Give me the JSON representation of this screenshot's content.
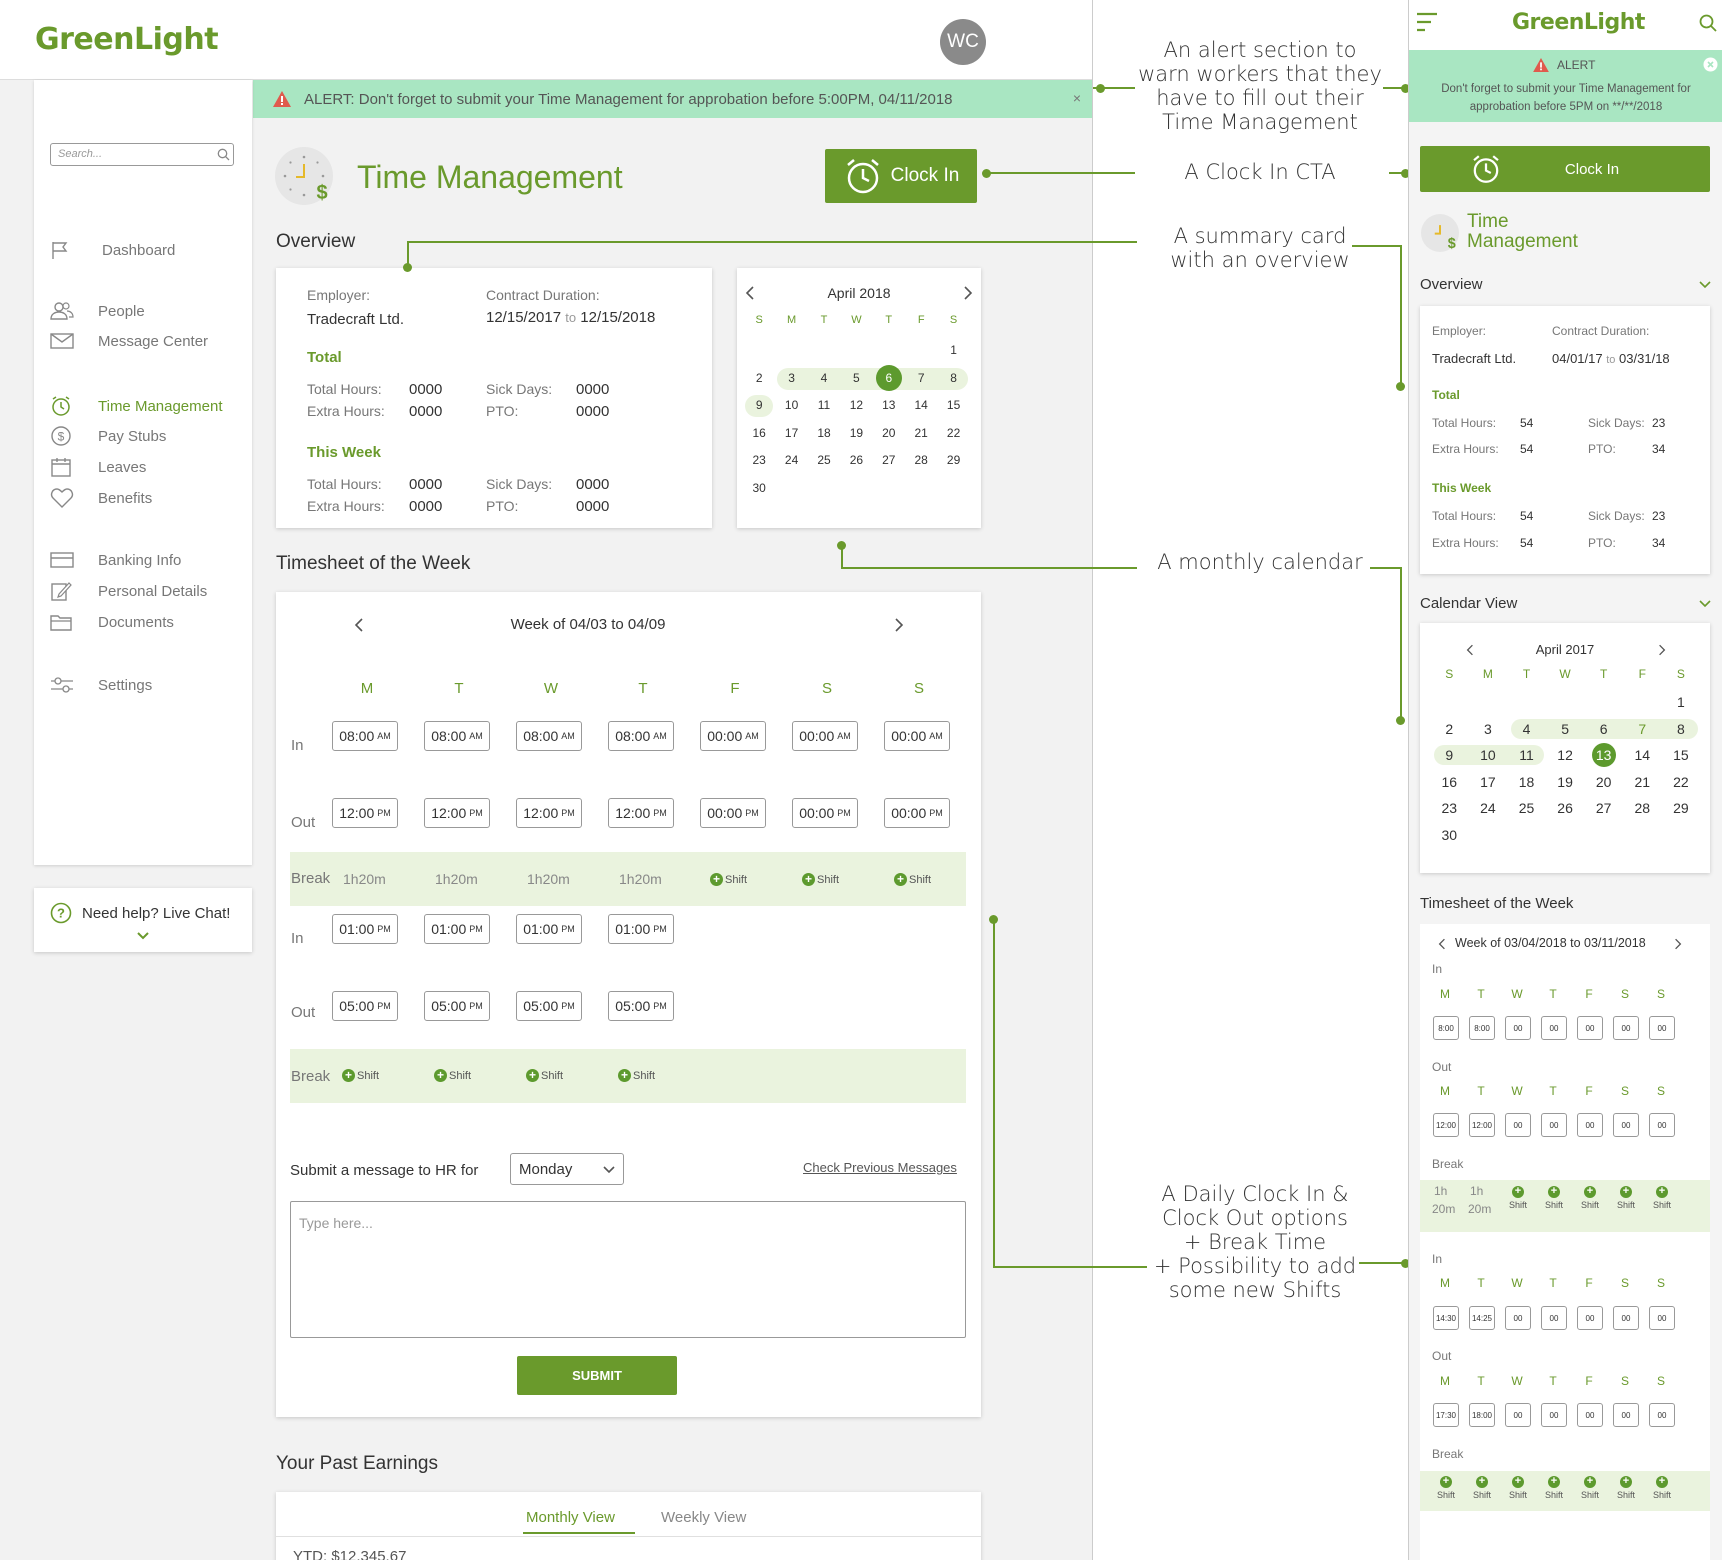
{
  "brand": {
    "logo": "GreenLight",
    "avatar_initials": "WC"
  },
  "alert": {
    "text": "ALERT: Don't forget to submit your Time Management for approbation before 5:00PM,  04/11/2018",
    "close": "×"
  },
  "search": {
    "placeholder": "Search..."
  },
  "nav": {
    "dashboard": "Dashboard",
    "people": "People",
    "messages": "Message Center",
    "time": "Time Management",
    "paystubs": "Pay Stubs",
    "leaves": "Leaves",
    "benefits": "Benefits",
    "banking": "Banking Info",
    "personal": "Personal Details",
    "documents": "Documents",
    "settings": "Settings"
  },
  "help": {
    "text": "Need help? Live Chat!"
  },
  "page": {
    "title": "Time Management",
    "clock_in": "Clock In",
    "overview": "Overview",
    "timesheet_title": "Timesheet of the Week",
    "earnings_title": "Your Past Earnings"
  },
  "overview": {
    "employer_label": "Employer:",
    "employer": "Tradecraft Ltd.",
    "contract_label": "Contract Duration:",
    "contract_from": "12/15/2017",
    "contract_to_word": "to",
    "contract_to": "12/15/2018",
    "total_heading": "Total",
    "week_heading": "This Week",
    "total_hours_label": "Total Hours:",
    "extra_hours_label": "Extra Hours:",
    "sick_label": "Sick Days:",
    "pto_label": "PTO:",
    "total": {
      "hours": "0000",
      "extra": "0000",
      "sick": "0000",
      "pto": "0000"
    },
    "week": {
      "hours": "0000",
      "extra": "0000",
      "sick": "0000",
      "pto": "0000"
    }
  },
  "calendar": {
    "month": "April 2018",
    "days": [
      "S",
      "M",
      "T",
      "W",
      "T",
      "F",
      "S"
    ],
    "weeks": [
      [
        "",
        "",
        "",
        "",
        "",
        "",
        "1"
      ],
      [
        "2",
        "3",
        "4",
        "5",
        "6",
        "7",
        "8"
      ],
      [
        "9",
        "10",
        "11",
        "12",
        "13",
        "14",
        "15"
      ],
      [
        "16",
        "17",
        "18",
        "19",
        "20",
        "21",
        "22"
      ],
      [
        "23",
        "24",
        "25",
        "26",
        "27",
        "28",
        "29"
      ],
      [
        "30",
        "",
        "",
        "",
        "",
        "",
        ""
      ]
    ],
    "selected": "6"
  },
  "timesheet": {
    "week_label": "Week of 04/03 to 04/09",
    "days": [
      "M",
      "T",
      "W",
      "T",
      "F",
      "S",
      "S"
    ],
    "row_in": "In",
    "row_out": "Out",
    "row_break": "Break",
    "shift": "Shift",
    "in1": [
      "08:00",
      "08:00",
      "08:00",
      "08:00",
      "00:00",
      "00:00",
      "00:00"
    ],
    "in1_ampm": "AM",
    "out1": [
      "12:00",
      "12:00",
      "12:00",
      "12:00",
      "00:00",
      "00:00",
      "00:00"
    ],
    "pm": "PM",
    "break1": [
      "1h20m",
      "1h20m",
      "1h20m",
      "1h20m"
    ],
    "in2": [
      "01:00",
      "01:00",
      "01:00",
      "01:00"
    ],
    "out2": [
      "05:00",
      "05:00",
      "05:00",
      "05:00"
    ],
    "message_label": "Submit a message to HR for",
    "message_day": "Monday",
    "check_previous": "Check Previous Messages",
    "textarea_placeholder": "Type here...",
    "submit": "SUBMIT"
  },
  "earnings": {
    "tab_monthly": "Monthly View",
    "tab_weekly": "Weekly View",
    "ytd": "YTD: $12,345.67"
  },
  "annotations": {
    "alert": "An alert section to\nwarn workers that they\nhave to fill out their\nTime Management",
    "clockin": "A Clock In CTA",
    "summary": "A summary card\nwith an overview",
    "calendar": "A monthly calendar",
    "daily": "A Daily Clock In &\nClock Out options\n+ Break Time\n+ Possibility to add\nsome new Shifts"
  },
  "mobile": {
    "alert_title": "ALERT",
    "alert_text": "Don't forget to submit your Time Management for approbation before 5PM on **/**/2018",
    "clock_in": "Clock In",
    "title_line1": "Time",
    "title_line2": "Management",
    "overview": "Overview",
    "employer": "Tradecraft Ltd.",
    "contract_from": "04/01/17",
    "contract_to": "03/31/18",
    "total": {
      "hours": "54",
      "extra": "54",
      "sick": "23",
      "pto": "34"
    },
    "week": {
      "hours": "54",
      "extra": "54",
      "sick": "23",
      "pto": "34"
    },
    "calendar_view": "Calendar View",
    "cal_month": "April 2017",
    "cal_weeks": [
      [
        "",
        "",
        "",
        "",
        "",
        "",
        "1"
      ],
      [
        "2",
        "3",
        "4",
        "5",
        "6",
        "7",
        "8"
      ],
      [
        "9",
        "10",
        "11",
        "12",
        "13",
        "14",
        "15"
      ],
      [
        "16",
        "17",
        "18",
        "19",
        "20",
        "21",
        "22"
      ],
      [
        "23",
        "24",
        "25",
        "26",
        "27",
        "28",
        "29"
      ],
      [
        "30",
        "",
        "",
        "",
        "",
        "",
        ""
      ]
    ],
    "cal_selected": "13",
    "timesheet_title": "Timesheet of the Week",
    "week_label": "Week of 03/04/2018 to 03/11/2018",
    "days": [
      "M",
      "T",
      "W",
      "T",
      "F",
      "S",
      "S"
    ],
    "in1": [
      "8:00",
      "8:00",
      "00",
      "00",
      "00",
      "00",
      "00"
    ],
    "out1": [
      "12:00",
      "12:00",
      "00",
      "00",
      "00",
      "00",
      "00"
    ],
    "break1_a": [
      "1h",
      "1h"
    ],
    "break1_b": [
      "20m",
      "20m"
    ],
    "in2": [
      "14:30",
      "14:25",
      "00",
      "00",
      "00",
      "00",
      "00"
    ],
    "out2": [
      "17:30",
      "18:00",
      "00",
      "00",
      "00",
      "00",
      "00"
    ],
    "row_in": "In",
    "row_out": "Out",
    "row_break": "Break",
    "shift": "Shift"
  },
  "colors": {
    "brand_green": "#6a9a2c",
    "alert_bg": "#a9e6c2",
    "light_green_row": "#eaf3de"
  }
}
